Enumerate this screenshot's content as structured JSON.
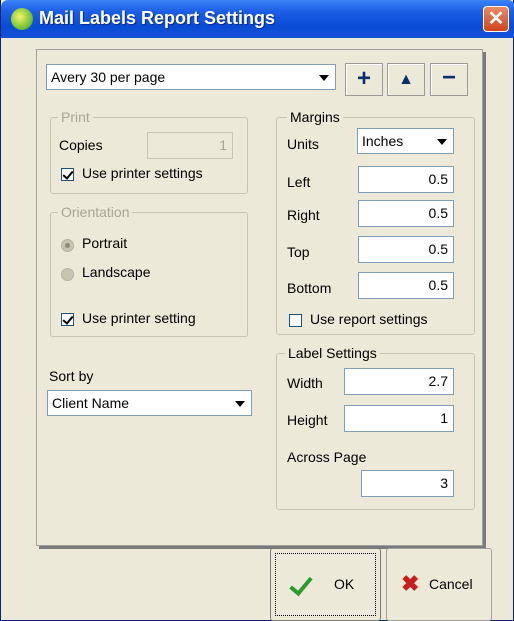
{
  "window": {
    "title": "Mail Labels Report Settings",
    "close_glyph": "✕",
    "icon": "app-icon"
  },
  "format_select": {
    "value": "Avery 30 per page"
  },
  "toolbar": {
    "add": "+",
    "up": "▲",
    "remove": "−"
  },
  "print": {
    "legend": "Print",
    "copies_label": "Copies",
    "copies_value": "1",
    "use_printer_settings": {
      "label": "Use printer settings",
      "checked": true
    }
  },
  "orientation": {
    "legend": "Orientation",
    "portrait": "Portrait",
    "landscape": "Landscape",
    "selected": "Portrait",
    "use_printer_setting": {
      "label": "Use printer setting",
      "checked": true
    }
  },
  "sort": {
    "label": "Sort by",
    "value": "Client Name"
  },
  "margins": {
    "legend": "Margins",
    "units_label": "Units",
    "units_value": "Inches",
    "left_label": "Left",
    "left": "0.5",
    "right_label": "Right",
    "right": "0.5",
    "top_label": "Top",
    "top": "0.5",
    "bottom_label": "Bottom",
    "bottom": "0.5",
    "use_report_settings": {
      "label": "Use report settings",
      "checked": false
    }
  },
  "label_settings": {
    "legend": "Label Settings",
    "width_label": "Width",
    "width": "2.7",
    "height_label": "Height",
    "height": "1",
    "across_label": "Across Page",
    "across": "3"
  },
  "buttons": {
    "ok": "OK",
    "cancel": "Cancel"
  },
  "colors": {
    "title_bar": "#0a4bd6",
    "dialog_bg": "#ece9d8",
    "ok_icon": "#2c9a2c",
    "cancel_icon": "#c81e1e"
  }
}
